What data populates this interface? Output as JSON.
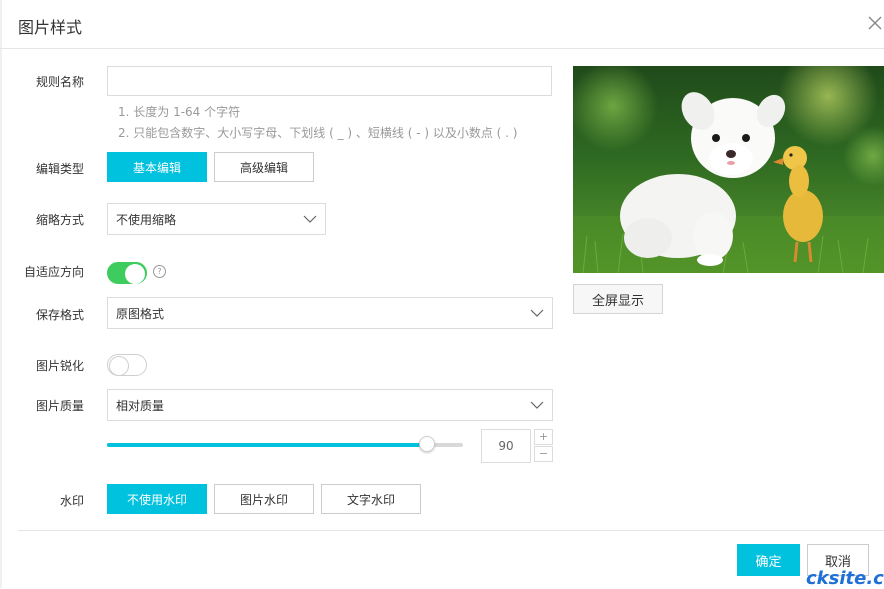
{
  "dialog": {
    "title": "图片样式"
  },
  "form": {
    "rule_name": {
      "label": "规则名称",
      "value": "",
      "placeholder": ""
    },
    "hints": [
      "1. 长度为 1-64 个字符",
      "2. 只能包含数字、大小写字母、下划线 ( _ ) 、短横线 ( - ) 以及小数点 ( . )"
    ],
    "edit_type": {
      "label": "编辑类型",
      "options": [
        "基本编辑",
        "高级编辑"
      ],
      "selected": "基本编辑"
    },
    "resize": {
      "label": "缩略方式",
      "value": "不使用缩略"
    },
    "auto_orient": {
      "label": "自适应方向",
      "enabled": true,
      "help": "?"
    },
    "save_format": {
      "label": "保存格式",
      "value": "原图格式"
    },
    "sharpen": {
      "label": "图片锐化",
      "enabled": false
    },
    "quality": {
      "label": "图片质量",
      "value": "相对质量",
      "slider_value": 90,
      "slider_fraction": 0.9,
      "stepper_up": "+",
      "stepper_down": "−"
    },
    "watermark": {
      "label": "水印",
      "options": [
        "不使用水印",
        "图片水印",
        "文字水印"
      ],
      "selected": "不使用水印"
    }
  },
  "preview": {
    "fullscreen_label": "全屏显示"
  },
  "footer": {
    "confirm_label": "确定",
    "cancel_label": "取消"
  },
  "site_watermark": "cksite.cn",
  "colors": {
    "primary": "#00c1de",
    "toggle_on": "#3ecc5e",
    "text": "#333333",
    "hint": "#999999",
    "border": "#dcdcdc",
    "watermark": "#1e6fd6"
  },
  "icons": {
    "close": "close-icon",
    "chevron": "chevron-down-icon",
    "help": "help-icon"
  }
}
